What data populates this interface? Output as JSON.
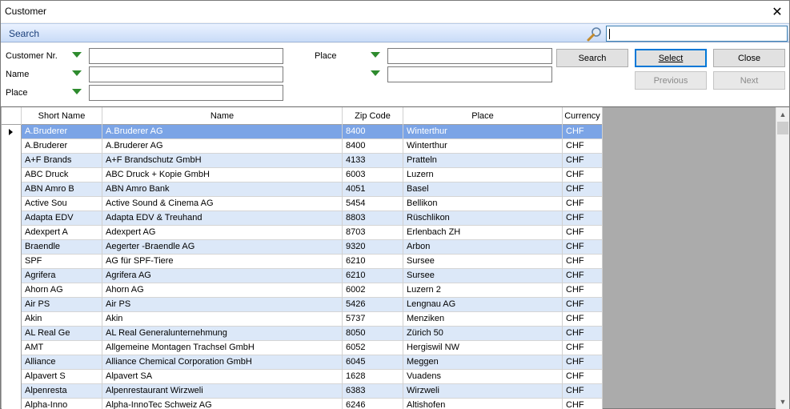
{
  "window": {
    "title": "Customer"
  },
  "search_bar": {
    "label": "Search",
    "quick_value": ""
  },
  "filters": {
    "customer_nr_label": "Customer Nr.",
    "name_label": "Name",
    "place_label": "Place",
    "place2_label": "Place",
    "search_button": "Search",
    "select_button": "Select",
    "close_button": "Close",
    "previous_button": "Previous",
    "next_button": "Next"
  },
  "grid": {
    "columns": [
      "Short Name",
      "Name",
      "Zip Code",
      "Place",
      "Currency"
    ],
    "rows": [
      [
        "A.Bruderer",
        "A.Bruderer AG",
        "8400",
        "Winterthur",
        "CHF"
      ],
      [
        "A.Bruderer",
        "A.Bruderer AG",
        "8400",
        "Winterthur",
        "CHF"
      ],
      [
        "A+F Brands",
        "A+F Brandschutz GmbH",
        "4133",
        "Pratteln",
        "CHF"
      ],
      [
        "ABC Druck",
        "ABC Druck + Kopie GmbH",
        "6003",
        "Luzern",
        "CHF"
      ],
      [
        "ABN Amro B",
        "ABN Amro Bank",
        "4051",
        "Basel",
        "CHF"
      ],
      [
        "Active Sou",
        "Active Sound & Cinema AG",
        "5454",
        "Bellikon",
        "CHF"
      ],
      [
        "Adapta EDV",
        "Adapta EDV & Treuhand",
        "8803",
        "Rüschlikon",
        "CHF"
      ],
      [
        "Adexpert A",
        "Adexpert AG",
        "8703",
        "Erlenbach ZH",
        "CHF"
      ],
      [
        "Braendle",
        "Aegerter -Braendle AG",
        "9320",
        "Arbon",
        "CHF"
      ],
      [
        "SPF",
        "AG für SPF-Tiere",
        "6210",
        "Sursee",
        "CHF"
      ],
      [
        "Agrifera",
        "Agrifera AG",
        "6210",
        "Sursee",
        "CHF"
      ],
      [
        "Ahorn AG",
        "Ahorn AG",
        "6002",
        "Luzern 2",
        "CHF"
      ],
      [
        "Air PS",
        "Air PS",
        "5426",
        "Lengnau AG",
        "CHF"
      ],
      [
        "Akin",
        "Akin",
        "5737",
        "Menziken",
        "CHF"
      ],
      [
        "AL Real Ge",
        "AL Real Generalunternehmung",
        "8050",
        "Zürich 50",
        "CHF"
      ],
      [
        "AMT",
        "Allgemeine Montagen Trachsel GmbH",
        "6052",
        "Hergiswil NW",
        "CHF"
      ],
      [
        "Alliance",
        "Alliance Chemical Corporation GmbH",
        "6045",
        "Meggen",
        "CHF"
      ],
      [
        "Alpavert S",
        "Alpavert SA",
        "1628",
        "Vuadens",
        "CHF"
      ],
      [
        "Alpenresta",
        "Alpenrestaurant Wirzweli",
        "6383",
        "Wirzweli",
        "CHF"
      ],
      [
        "Alpha-Inno",
        "Alpha-InnoTec Schweiz AG",
        "6246",
        "Altishofen",
        "CHF"
      ]
    ]
  }
}
